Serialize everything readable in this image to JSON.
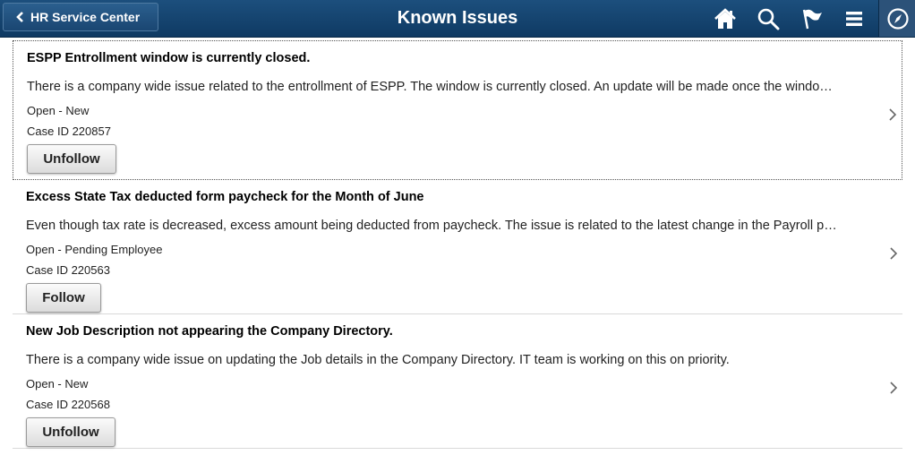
{
  "header": {
    "back_label": "HR Service Center",
    "title": "Known Issues",
    "icons": [
      "home-icon",
      "search-icon",
      "flag-icon",
      "menu-icon",
      "navbar-compass-icon"
    ],
    "colors": {
      "banner": "#1c4f7d",
      "text": "#ffffff"
    }
  },
  "issues": [
    {
      "title": "ESPP Entrollment window is currently closed.",
      "description": "There is a company wide issue related to the entrollment of ESPP. The window is currently closed. An update will be made once the windo…",
      "status": "Open - New",
      "case_id": "Case ID 220857",
      "button": "Unfollow"
    },
    {
      "title": "Excess State Tax deducted form paycheck for the Month of June",
      "description": "Even though tax rate is decreased, excess amount being deducted from paycheck. The issue is related to the latest change in the Payroll p…",
      "status": "Open - Pending Employee",
      "case_id": "Case ID 220563",
      "button": "Follow"
    },
    {
      "title": "New Job Description not appearing the Company Directory.",
      "description": "There is a company wide issue on updating the Job details in the Company Directory. IT team is working on this on priority.",
      "status": "Open - New",
      "case_id": "Case ID 220568",
      "button": "Unfollow"
    }
  ]
}
